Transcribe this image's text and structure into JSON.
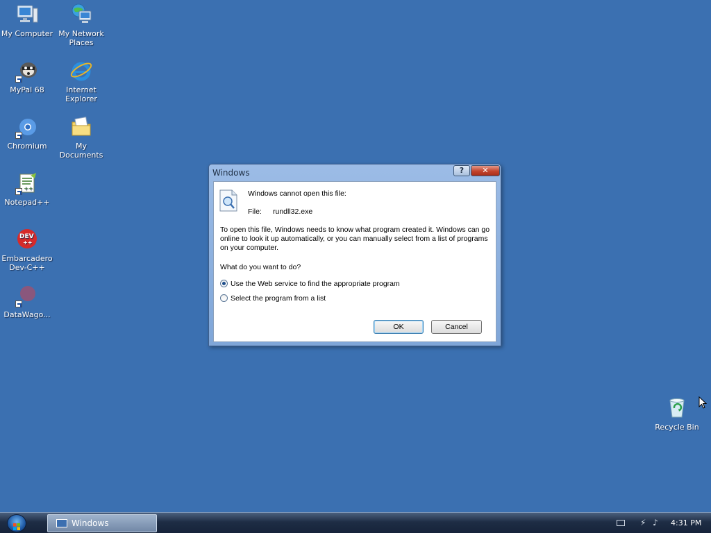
{
  "desktop": {
    "icons": [
      {
        "label": "My Computer"
      },
      {
        "label": "My Network Places"
      },
      {
        "label": "MyPal 68"
      },
      {
        "label": "Internet Explorer"
      },
      {
        "label": "Chromium"
      },
      {
        "label": "My Documents"
      },
      {
        "label": "Notepad++"
      },
      {
        "label": "Embarcadero Dev-C++"
      },
      {
        "label": "DataWago..."
      },
      {
        "label": "Recycle Bin"
      }
    ]
  },
  "dialog": {
    "title": "Windows",
    "help_label": "?",
    "close_label": "✕",
    "message": "Windows cannot open this file:",
    "file_label": "File:",
    "file_name": "rundll32.exe",
    "explanation": "To open this file, Windows needs to know what program created it.  Windows can go online to look it up automatically, or you can manually select from a list of programs on your computer.",
    "question": "What do you want to do?",
    "options": [
      {
        "label": "Use the Web service to find the appropriate program",
        "selected": true
      },
      {
        "label": "Select the program from a list",
        "selected": false
      }
    ],
    "ok_label": "OK",
    "cancel_label": "Cancel"
  },
  "taskbar": {
    "window_label": "Windows",
    "clock": "4:31 PM"
  }
}
